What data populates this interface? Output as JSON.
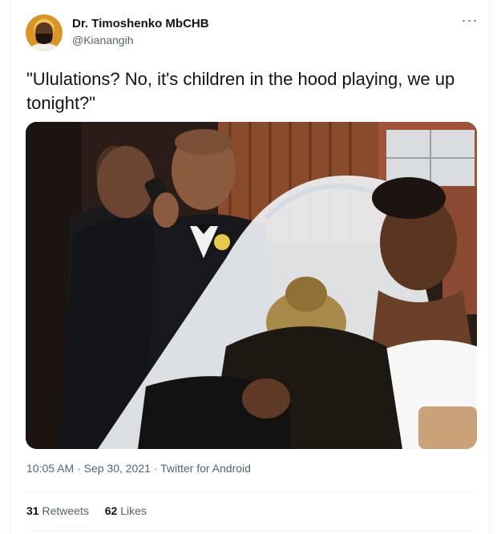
{
  "author": {
    "display_name": "Dr. Timoshenko MbCHB",
    "handle": "@Kianangih"
  },
  "more_icon": "···",
  "tweet": {
    "text": "\"Ululations? No, it's children in the hood playing, we up tonight?\"",
    "time": "10:05 AM",
    "date": "Sep 30, 2021",
    "source": "Twitter for Android",
    "separator": " · "
  },
  "stats": {
    "retweets_count": "31",
    "retweets_label": "Retweets",
    "likes_count": "62",
    "likes_label": "Likes"
  },
  "colors": {
    "text_primary": "#0f1419",
    "text_secondary": "#536471",
    "divider": "#eff3f4"
  }
}
